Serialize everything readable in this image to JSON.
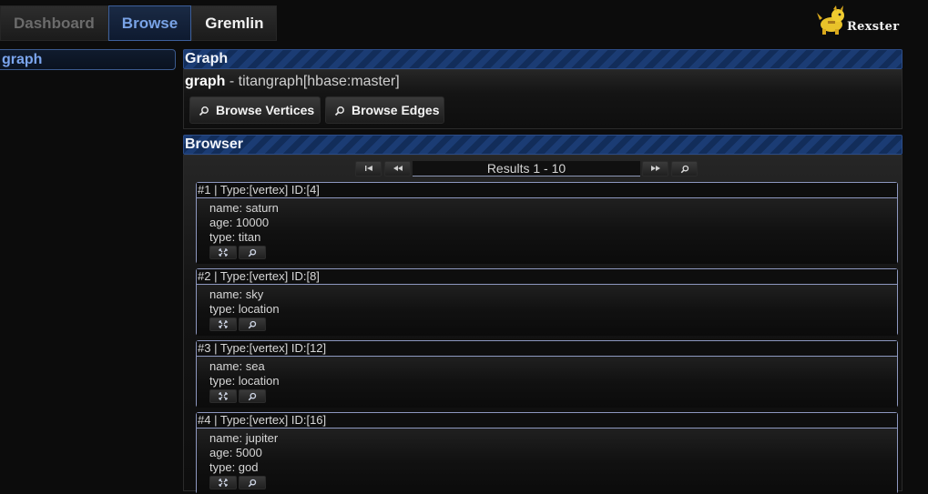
{
  "nav": {
    "tabs": [
      {
        "label": "Dashboard"
      },
      {
        "label": "Browse"
      },
      {
        "label": "Gremlin"
      }
    ]
  },
  "logo": {
    "text": "Rexster"
  },
  "sidebar": {
    "items": [
      {
        "label": "graph"
      }
    ]
  },
  "graph_panel": {
    "header": "Graph",
    "graph_name": "graph",
    "graph_desc": " - titangraph[hbase:master]",
    "browse_vertices": "Browse Vertices",
    "browse_edges": "Browse Edges"
  },
  "browser_panel": {
    "header": "Browser",
    "results_label": "Results 1 - 10",
    "pager_icons": [
      "first-page-icon",
      "previous-page-icon",
      "next-page-icon",
      "search-icon"
    ]
  },
  "results": [
    {
      "title": "#1 | Type:[vertex] ID:[4]",
      "props": [
        "name: saturn",
        "age: 10000",
        "type: titan"
      ]
    },
    {
      "title": "#2 | Type:[vertex] ID:[8]",
      "props": [
        "name: sky",
        "type: location"
      ]
    },
    {
      "title": "#3 | Type:[vertex] ID:[12]",
      "props": [
        "name: sea",
        "type: location"
      ]
    },
    {
      "title": "#4 | Type:[vertex] ID:[16]",
      "props": [
        "name: jupiter",
        "age: 5000",
        "type: god"
      ]
    }
  ],
  "colors": {
    "accent": "#79a3e6",
    "header_stripe": "#1b3c74",
    "card_border": "#8e98c0",
    "background": "#0c0c0c"
  }
}
